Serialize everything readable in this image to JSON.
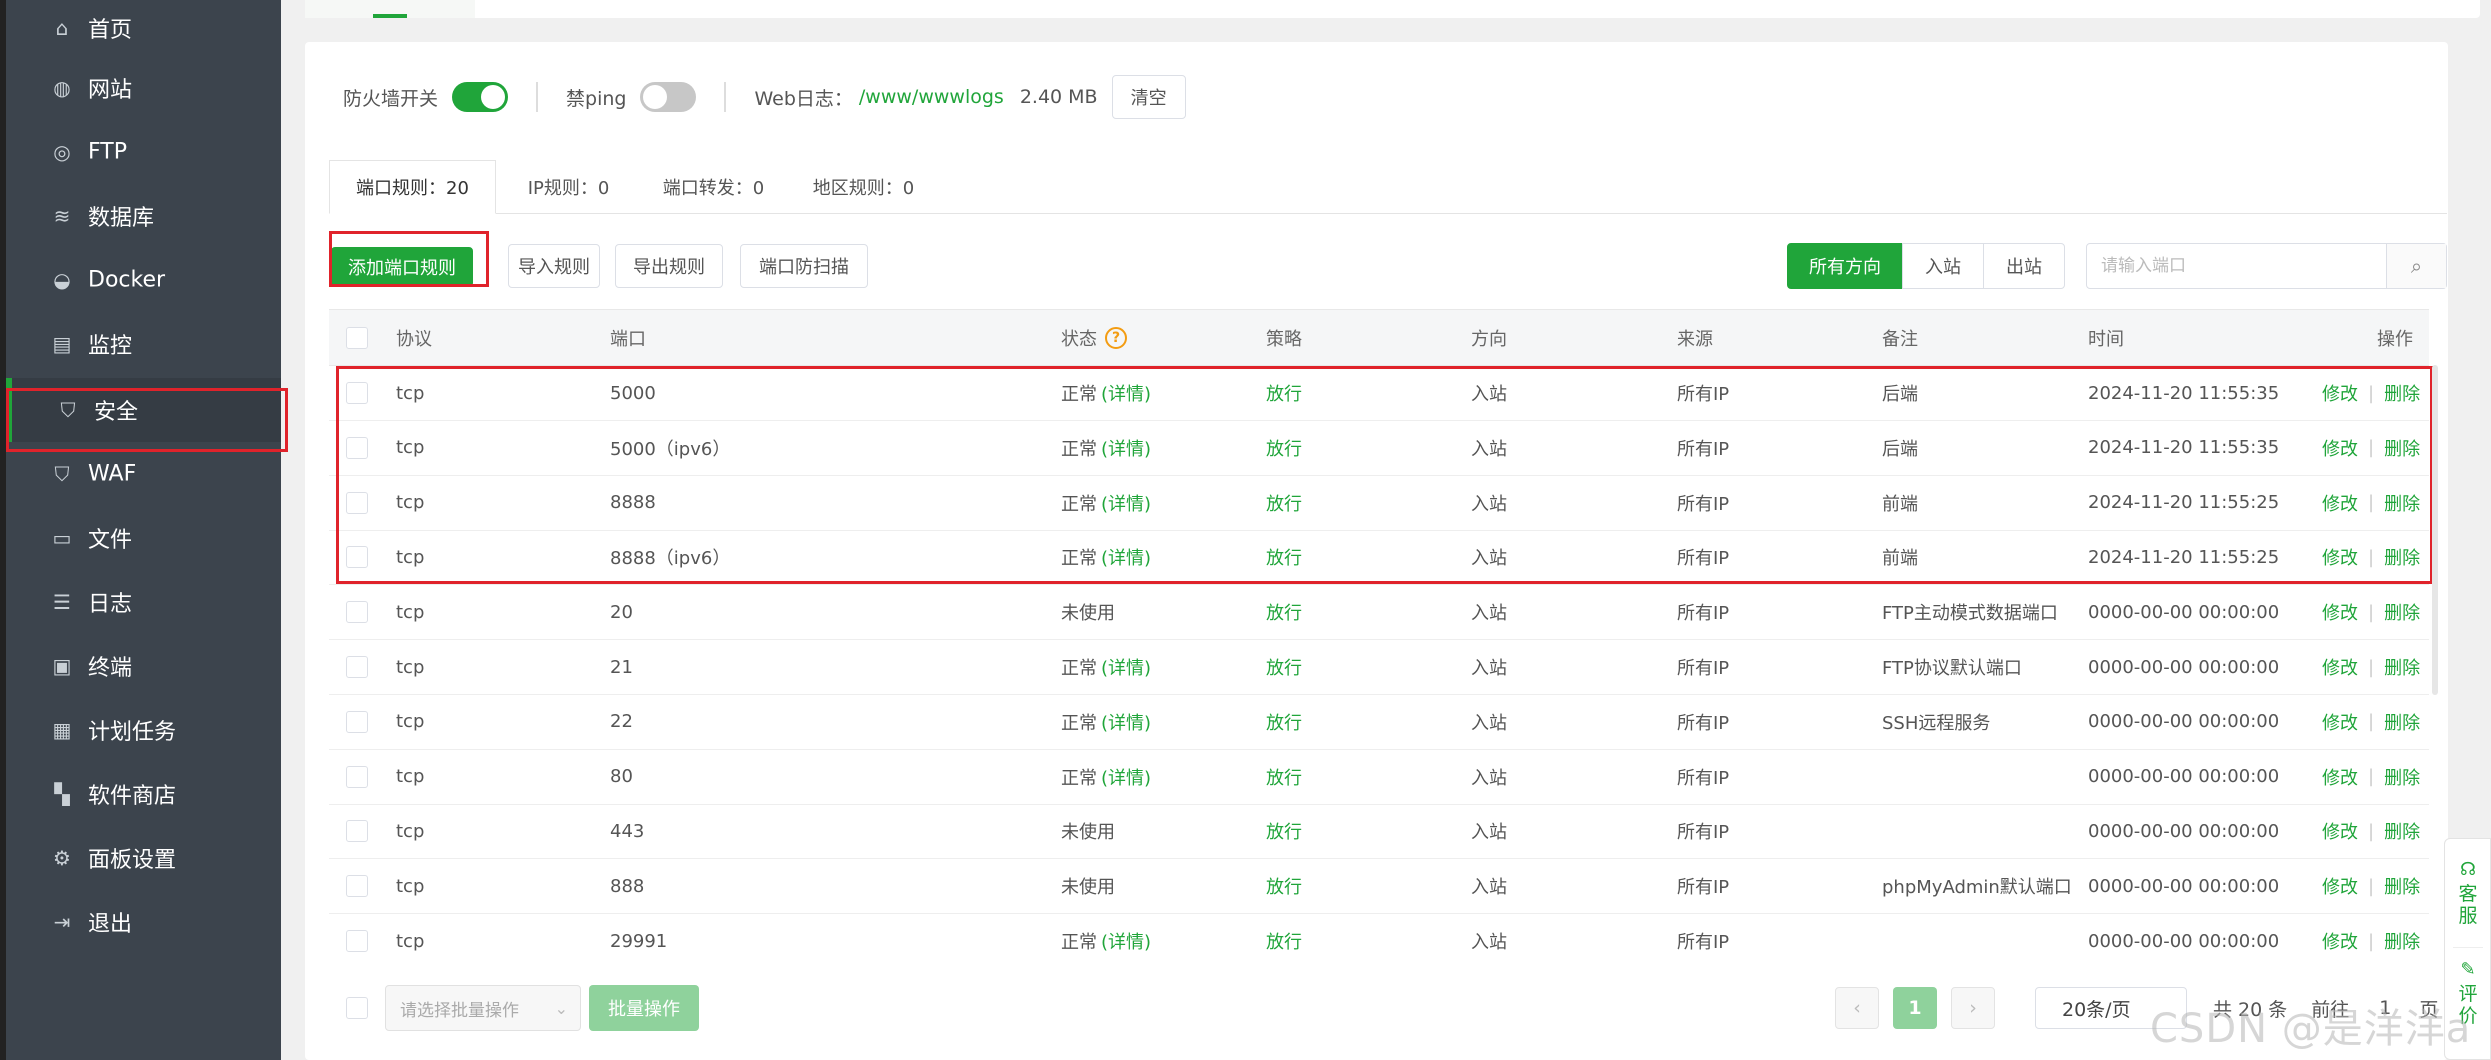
{
  "sidebar": {
    "items": [
      {
        "label": "首页",
        "icon": "home-icon",
        "glyph": "⌂"
      },
      {
        "label": "网站",
        "icon": "globe-icon",
        "glyph": "◍"
      },
      {
        "label": "FTP",
        "icon": "ftp-icon",
        "glyph": "◎"
      },
      {
        "label": "数据库",
        "icon": "database-icon",
        "glyph": "≋"
      },
      {
        "label": "Docker",
        "icon": "docker-icon",
        "glyph": "◒"
      },
      {
        "label": "监控",
        "icon": "monitor-icon",
        "glyph": "▤"
      },
      {
        "label": "安全",
        "icon": "shield-check-icon",
        "glyph": "⛉"
      },
      {
        "label": "WAF",
        "icon": "waf-shield-icon",
        "glyph": "⛉"
      },
      {
        "label": "文件",
        "icon": "folder-icon",
        "glyph": "▭"
      },
      {
        "label": "日志",
        "icon": "log-icon",
        "glyph": "☰"
      },
      {
        "label": "终端",
        "icon": "terminal-icon",
        "glyph": "▣"
      },
      {
        "label": "计划任务",
        "icon": "calendar-icon",
        "glyph": "▦"
      },
      {
        "label": "软件商店",
        "icon": "apps-icon",
        "glyph": "▚"
      },
      {
        "label": "面板设置",
        "icon": "gear-icon",
        "glyph": "⚙"
      },
      {
        "label": "退出",
        "icon": "logout-icon",
        "glyph": "⇥"
      }
    ],
    "active_index": 6
  },
  "firewall": {
    "switch_label": "防火墙开关",
    "switch_on": true,
    "ping_label": "禁ping",
    "ping_on": false,
    "weblog_label": "Web日志：",
    "weblog_path": "/www/wwwlogs",
    "weblog_size": "2.40 MB",
    "clear_label": "清空"
  },
  "tabs": [
    {
      "label": "端口规则：20"
    },
    {
      "label": "IP规则：0"
    },
    {
      "label": "端口转发：0"
    },
    {
      "label": "地区规则：0"
    }
  ],
  "toolbar": {
    "add_label": "添加端口规则",
    "import_label": "导入规则",
    "export_label": "导出规则",
    "scan_label": "端口防扫描"
  },
  "direction": {
    "all_label": "所有方向",
    "in_label": "入站",
    "out_label": "出站"
  },
  "search": {
    "placeholder": "请输入端口"
  },
  "table": {
    "headers": {
      "protocol": "协议",
      "port": "端口",
      "status": "状态",
      "policy": "策略",
      "direction": "方向",
      "source": "来源",
      "remark": "备注",
      "time": "时间",
      "ops": "操作"
    },
    "status_help_glyph": "?",
    "edit_label": "修改",
    "delete_label": "删除",
    "detail_label": "(详情)",
    "rows": [
      {
        "protocol": "tcp",
        "port": "5000",
        "status": "正常",
        "has_detail": true,
        "policy": "放行",
        "direction": "入站",
        "source": "所有IP",
        "remark": "后端",
        "time": "2024-11-20 11:55:35"
      },
      {
        "protocol": "tcp",
        "port": "5000（ipv6）",
        "status": "正常",
        "has_detail": true,
        "policy": "放行",
        "direction": "入站",
        "source": "所有IP",
        "remark": "后端",
        "time": "2024-11-20 11:55:35"
      },
      {
        "protocol": "tcp",
        "port": "8888",
        "status": "正常",
        "has_detail": true,
        "policy": "放行",
        "direction": "入站",
        "source": "所有IP",
        "remark": "前端",
        "time": "2024-11-20 11:55:25"
      },
      {
        "protocol": "tcp",
        "port": "8888（ipv6）",
        "status": "正常",
        "has_detail": true,
        "policy": "放行",
        "direction": "入站",
        "source": "所有IP",
        "remark": "前端",
        "time": "2024-11-20 11:55:25"
      },
      {
        "protocol": "tcp",
        "port": "20",
        "status": "未使用",
        "has_detail": false,
        "policy": "放行",
        "direction": "入站",
        "source": "所有IP",
        "remark": "FTP主动模式数据端口",
        "time": "0000-00-00 00:00:00"
      },
      {
        "protocol": "tcp",
        "port": "21",
        "status": "正常",
        "has_detail": true,
        "policy": "放行",
        "direction": "入站",
        "source": "所有IP",
        "remark": "FTP协议默认端口",
        "time": "0000-00-00 00:00:00"
      },
      {
        "protocol": "tcp",
        "port": "22",
        "status": "正常",
        "has_detail": true,
        "policy": "放行",
        "direction": "入站",
        "source": "所有IP",
        "remark": "SSH远程服务",
        "time": "0000-00-00 00:00:00"
      },
      {
        "protocol": "tcp",
        "port": "80",
        "status": "正常",
        "has_detail": true,
        "policy": "放行",
        "direction": "入站",
        "source": "所有IP",
        "remark": "",
        "time": "0000-00-00 00:00:00"
      },
      {
        "protocol": "tcp",
        "port": "443",
        "status": "未使用",
        "has_detail": false,
        "policy": "放行",
        "direction": "入站",
        "source": "所有IP",
        "remark": "",
        "time": "0000-00-00 00:00:00"
      },
      {
        "protocol": "tcp",
        "port": "888",
        "status": "未使用",
        "has_detail": false,
        "policy": "放行",
        "direction": "入站",
        "source": "所有IP",
        "remark": "phpMyAdmin默认端口",
        "time": "0000-00-00 00:00:00"
      },
      {
        "protocol": "tcp",
        "port": "29991",
        "status": "正常",
        "has_detail": true,
        "policy": "放行",
        "direction": "入站",
        "source": "所有IP",
        "remark": "",
        "time": "0000-00-00 00:00:00"
      }
    ]
  },
  "footer": {
    "batch_placeholder": "请选择批量操作",
    "batch_button": "批量操作",
    "prev_glyph": "‹",
    "next_glyph": "›",
    "current_page": "1",
    "page_size": "20条/页",
    "total_text": "共 20 条",
    "goto_text": "前往",
    "goto_value": "1",
    "page_suffix": "页"
  },
  "service": {
    "chat_label": "客服",
    "rate_label": "评价"
  },
  "watermark": "CSDN @是洋洋a",
  "colors": {
    "brand_green": "#20a53a",
    "sidebar_bg": "#3c444d",
    "highlight_red": "#e0232b"
  }
}
